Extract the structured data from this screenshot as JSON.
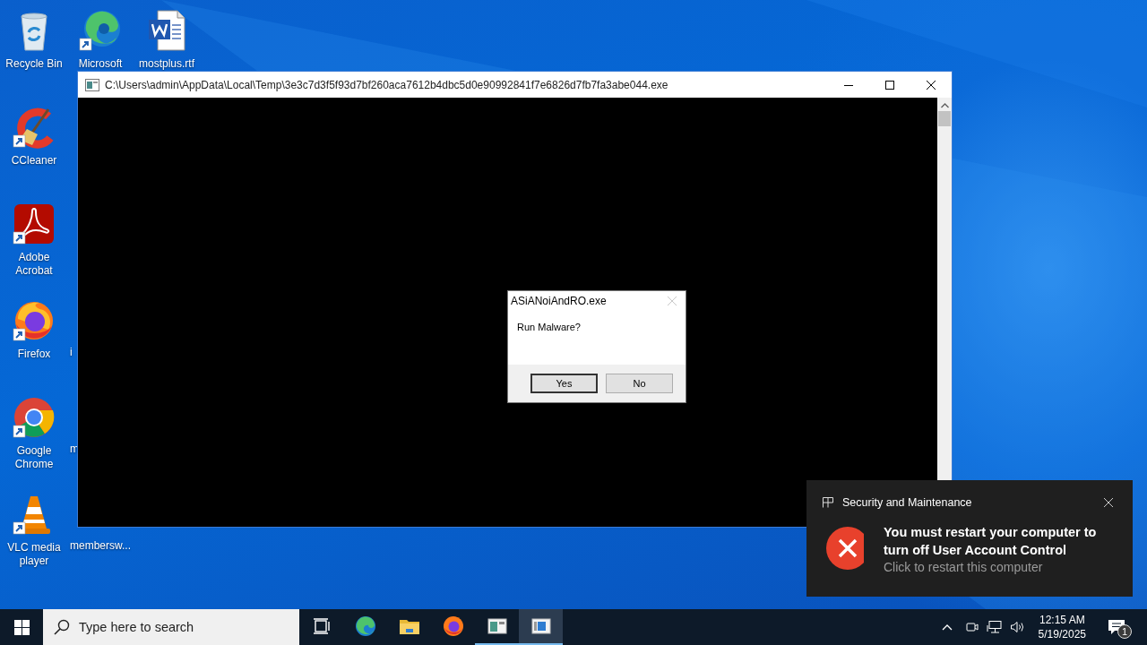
{
  "desktop_icons": [
    {
      "label": "Recycle Bin",
      "kind": "recycle"
    },
    {
      "label": "CCleaner",
      "kind": "ccleaner"
    },
    {
      "label": "Adobe Acrobat",
      "kind": "acrobat"
    },
    {
      "label": "Firefox",
      "kind": "firefox"
    },
    {
      "label": "Google Chrome",
      "kind": "chrome"
    },
    {
      "label": "VLC media player",
      "kind": "vlc"
    },
    {
      "label": "Microsoft",
      "kind": "edge"
    },
    {
      "label": "i",
      "kind": "covered"
    },
    {
      "label": "m",
      "kind": "covered"
    },
    {
      "label": "membersw...",
      "kind": "covered"
    },
    {
      "label": "mostplus.rtf",
      "kind": "word"
    }
  ],
  "console_window": {
    "title": "C:\\Users\\admin\\AppData\\Local\\Temp\\3e3c7d3f5f93d7bf260aca7612b4dbc5d0e90992841f7e6826d7fb7fa3abe044.exe"
  },
  "dialog": {
    "title": "ASiANoiAndRO.exe",
    "close_disabled": true,
    "message": "Run Malware?",
    "buttons": [
      {
        "label": "Yes",
        "default": true
      },
      {
        "label": "No",
        "default": false
      }
    ]
  },
  "notification": {
    "app": "Security and Maintenance",
    "title": "You must restart your computer to turn off User Account Control",
    "body": "Click to restart this computer"
  },
  "taskbar": {
    "search": {
      "placeholder": "Type here to search"
    },
    "apps": [
      {
        "kind": "taskview",
        "running": false,
        "active": false
      },
      {
        "kind": "edge",
        "running": false,
        "active": false
      },
      {
        "kind": "folder",
        "running": false,
        "active": false
      },
      {
        "kind": "firefox",
        "running": false,
        "active": false
      },
      {
        "kind": "console",
        "running": true,
        "active": false
      },
      {
        "kind": "dialog",
        "running": true,
        "active": true
      }
    ],
    "time": "12:15 AM",
    "date": "5/19/2025",
    "notification_count": "1"
  }
}
